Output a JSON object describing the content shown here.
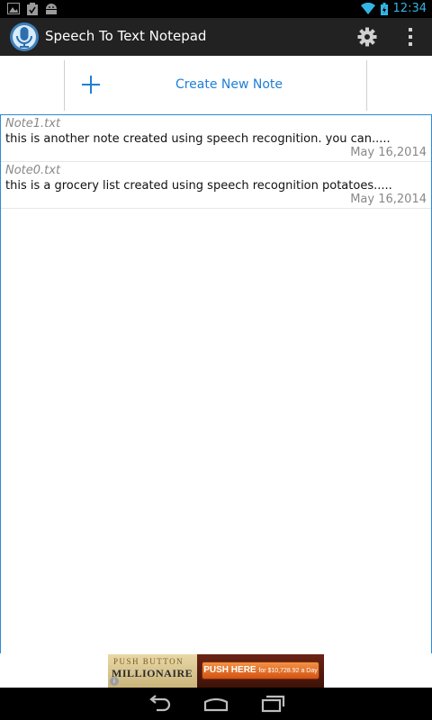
{
  "statusbar": {
    "time": "12:34",
    "notification_icons": [
      "image-icon",
      "clipboard-check-icon",
      "android-icon"
    ],
    "system_icons": [
      "wifi-icon",
      "battery-icon"
    ]
  },
  "actionbar": {
    "title": "Speech To Text Notepad",
    "app_icon": "microphone-icon",
    "settings_icon": "gear-icon",
    "overflow_icon": "overflow-menu-icon"
  },
  "create_note": {
    "label": "Create New Note",
    "icon": "plus-icon"
  },
  "notes": [
    {
      "filename": "Note1.txt",
      "preview": "this is another note created using speech recognition. you can.....",
      "date": "May 16,2014"
    },
    {
      "filename": "Note0.txt",
      "preview": "this is a grocery list created using speech recognition potatoes.....",
      "date": "May 16,2014"
    }
  ],
  "ad": {
    "line1": "PUSH BUTTON",
    "line2": "MILLIONAIRE",
    "cta": "PUSH HERE",
    "cta_sub": "for $10,728.92 a Day"
  },
  "navbar": {
    "back_icon": "back-icon",
    "home_icon": "home-icon",
    "recents_icon": "recents-icon"
  },
  "colors": {
    "accent": "#33b5e5",
    "link_blue": "#1f7fd6",
    "list_border": "#2e8ad6",
    "actionbar_bg": "#222222"
  }
}
